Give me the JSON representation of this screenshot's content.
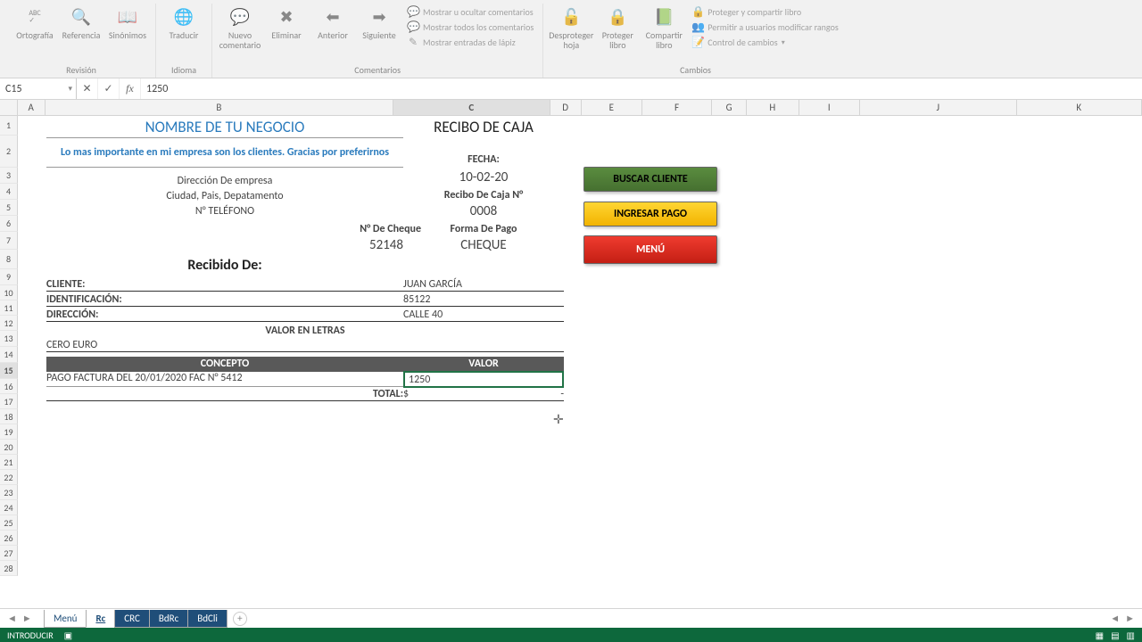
{
  "ribbon": {
    "groups": {
      "revision": {
        "label": "Revisión",
        "btns": [
          "Ortografía",
          "Referencia",
          "Sinónimos"
        ],
        "abc": "ABC"
      },
      "idioma": {
        "label": "Idioma",
        "btns": [
          "Traducir"
        ]
      },
      "comentarios": {
        "label": "Comentarios",
        "btns": [
          "Nuevo comentario",
          "Eliminar",
          "Anterior",
          "Siguiente"
        ],
        "items": [
          "Mostrar u ocultar comentarios",
          "Mostrar todos los comentarios",
          "Mostrar entradas de lápiz"
        ]
      },
      "cambios": {
        "label": "Cambios",
        "btns": [
          "Desproteger hoja",
          "Proteger libro",
          "Compartir libro"
        ],
        "items": [
          "Proteger y compartir libro",
          "Permitir a usuarios modificar rangos",
          "Control de cambios"
        ]
      }
    }
  },
  "namebox": "C15",
  "formula": "1250",
  "columns": [
    "A",
    "B",
    "C",
    "D",
    "E",
    "F",
    "G",
    "H",
    "I",
    "J",
    "K"
  ],
  "rows_count": 28,
  "selected_row": 15,
  "selected_col": "C",
  "receipt": {
    "business_name": "NOMBRE DE TU NEGOCIO",
    "title": "RECIBO DE CAJA",
    "slogan": "Lo mas importante en mi empresa son los clientes. Gracias por preferirnos",
    "address": "Dirección De empresa",
    "city": "Ciudad, Pais, Depatamento",
    "phone": "N° TELÉFONO",
    "date_label": "FECHA:",
    "date": "10-02-20",
    "number_label": "Recibo De Caja N°",
    "number": "0008",
    "cheque_label": "N° De Cheque",
    "cheque": "52148",
    "payform_label": "Forma De Pago",
    "payform": "CHEQUE",
    "received_label": "Recibido De:",
    "client_label": "CLIENTE:",
    "client": "JUAN GARCÍA",
    "id_label": "IDENTIFICACIÓN:",
    "id": "85122",
    "addr_label": "DIRECCIÓN:",
    "addr": "CALLE 40",
    "words_label": "VALOR EN LETRAS",
    "words": "CERO EURO",
    "col_concepto": "CONCEPTO",
    "col_valor": "VALOR",
    "row_concepto": "PAGO FACTURA DEL 20/01/2020 FAC N° 5412",
    "row_valor": "1250",
    "total_label": "TOTAL:",
    "total_currency": "$",
    "total_value": "-"
  },
  "buttons": {
    "search": "BUSCAR CLIENTE",
    "pay": "INGRESAR PAGO",
    "menu": "MENÚ"
  },
  "tabs": [
    "Menú",
    "Rc",
    "CRC",
    "BdRc",
    "BdCli"
  ],
  "active_tab": "Rc",
  "status": "INTRODUCIR"
}
